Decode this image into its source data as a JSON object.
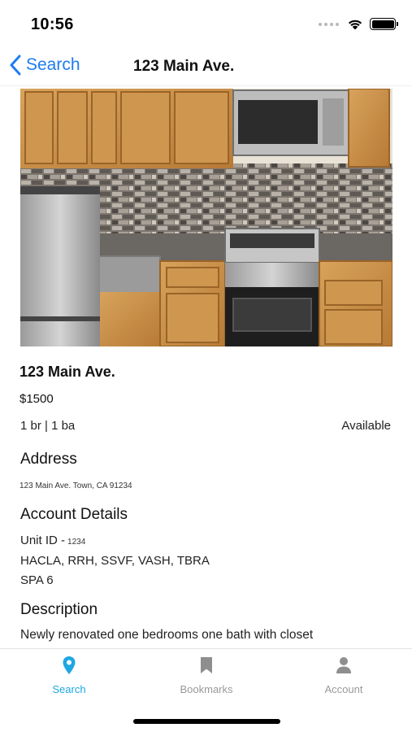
{
  "status_bar": {
    "time": "10:56"
  },
  "nav": {
    "back_label": "Search",
    "title": "123 Main Ave."
  },
  "listing": {
    "title": "123 Main Ave.",
    "price": "$1500",
    "rooms": "1 br | 1 ba",
    "status": "Available"
  },
  "address": {
    "heading": "Address",
    "text": "123 Main Ave. Town, CA 91234"
  },
  "account_details": {
    "heading": "Account Details",
    "unit_id_label": "Unit ID -",
    "unit_id_value": "1234",
    "programs": "HACLA, RRH, SSVF, VASH, TBRA",
    "spa": "SPA 6"
  },
  "description": {
    "heading": "Description",
    "text": "Newly renovated one bedrooms one bath with closet"
  },
  "tabs": [
    {
      "label": "Search",
      "icon": "location-pin-icon",
      "active": true
    },
    {
      "label": "Bookmarks",
      "icon": "bookmark-icon",
      "active": false
    },
    {
      "label": "Account",
      "icon": "person-icon",
      "active": false
    }
  ],
  "colors": {
    "accent": "#1ea7e4",
    "nav_link": "#1d7cf2",
    "inactive": "#999999"
  }
}
